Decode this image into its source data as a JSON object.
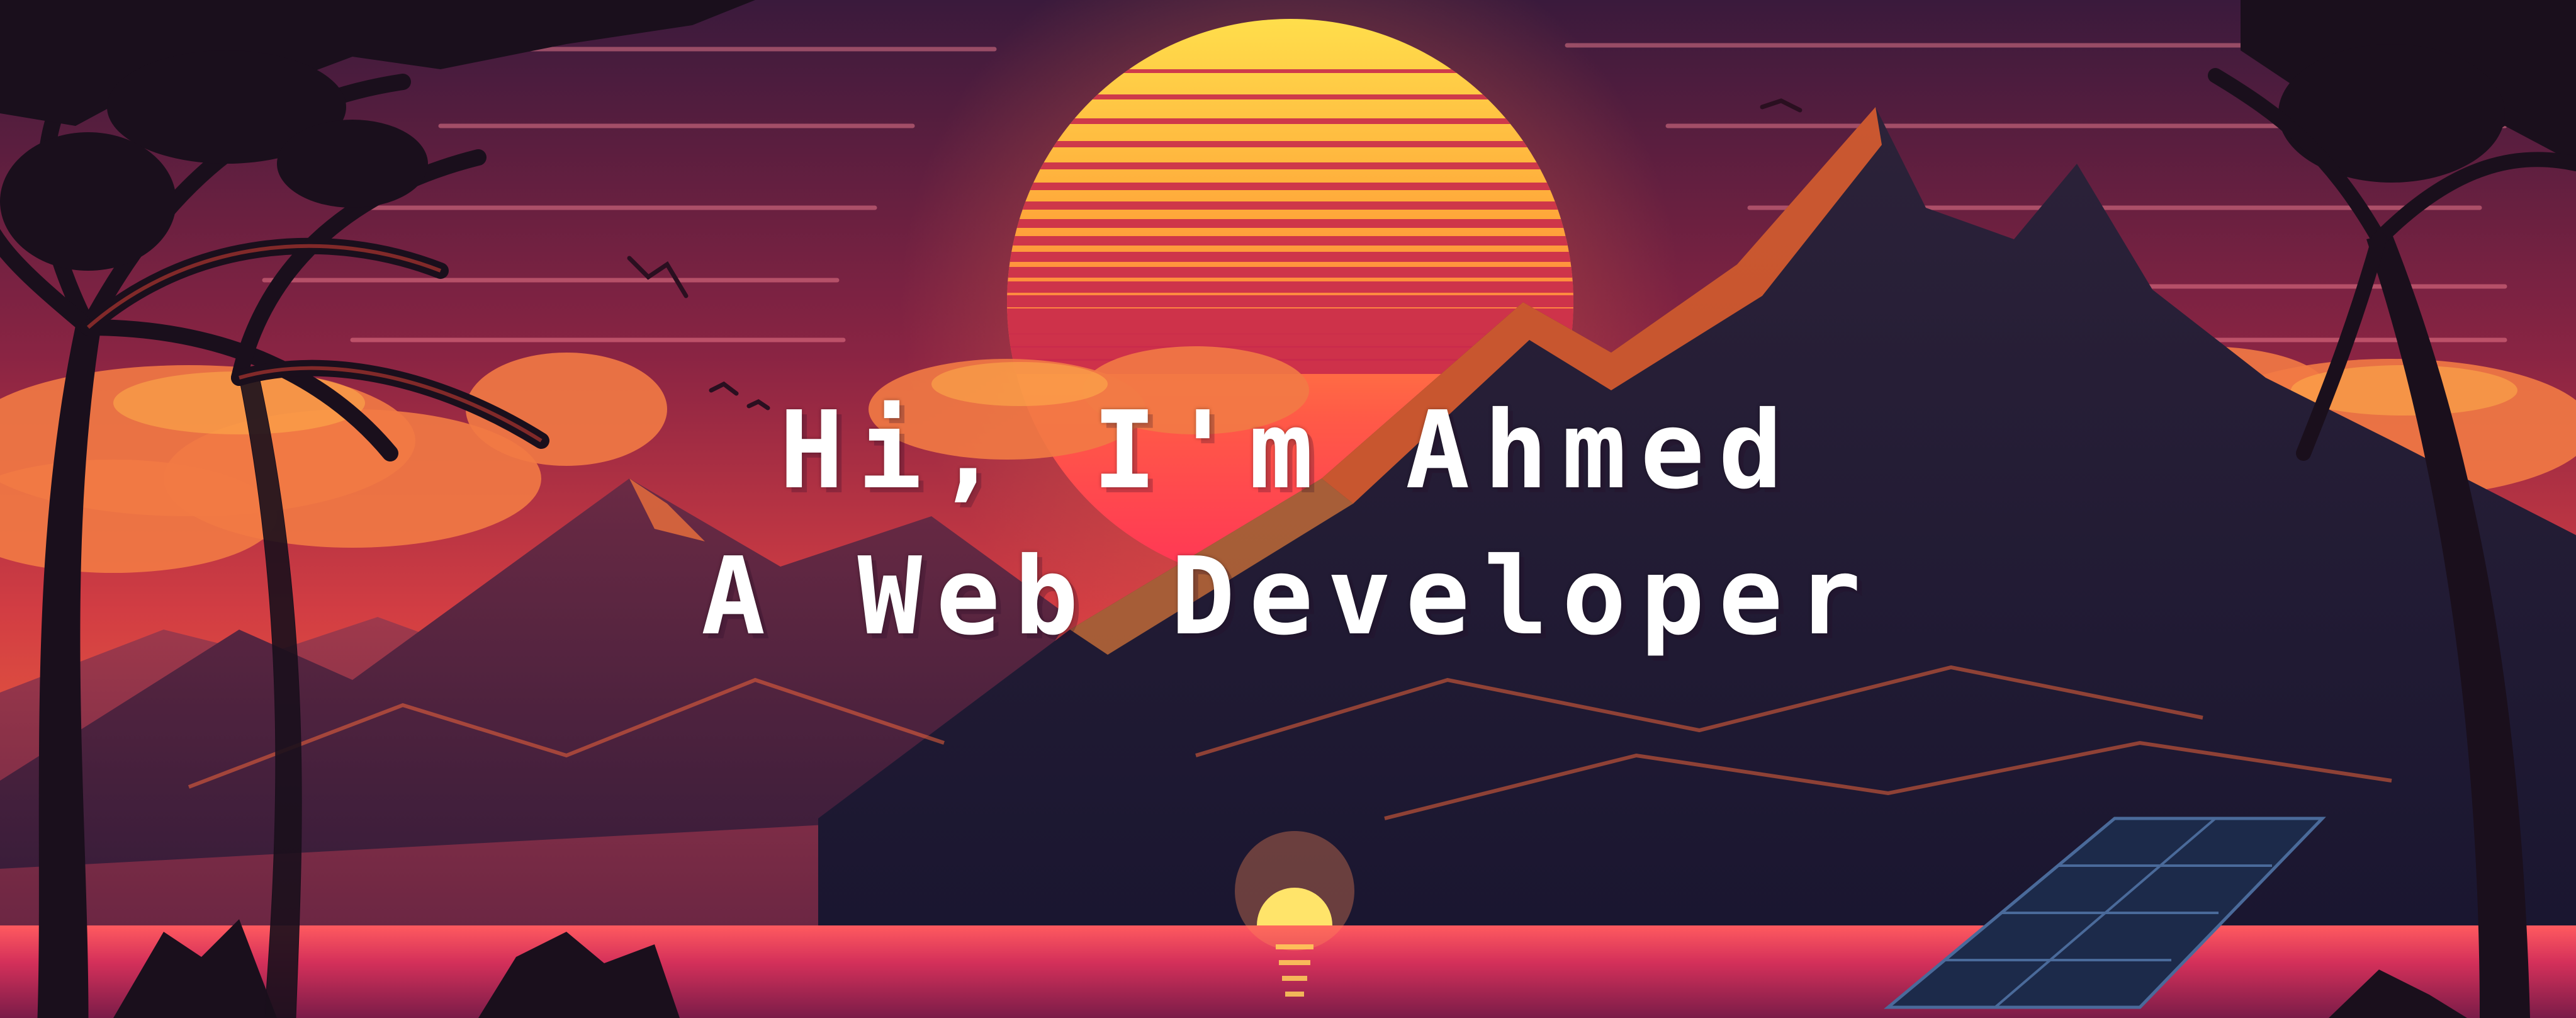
{
  "hero": {
    "line1": "Hi, I'm Ahmed",
    "line2": "A Web Developer"
  },
  "palette": {
    "sky_top": "#3a1a3c",
    "sky_mid": "#b52c44",
    "sky_low": "#f0643a",
    "sun_top": "#ffd84a",
    "sun_bottom": "#ff3d5c",
    "mountain_dark": "#1f1a33",
    "mountain_rim": "#ff6a2e",
    "sea": "#d8305a",
    "foliage": "#1a0f1c"
  }
}
